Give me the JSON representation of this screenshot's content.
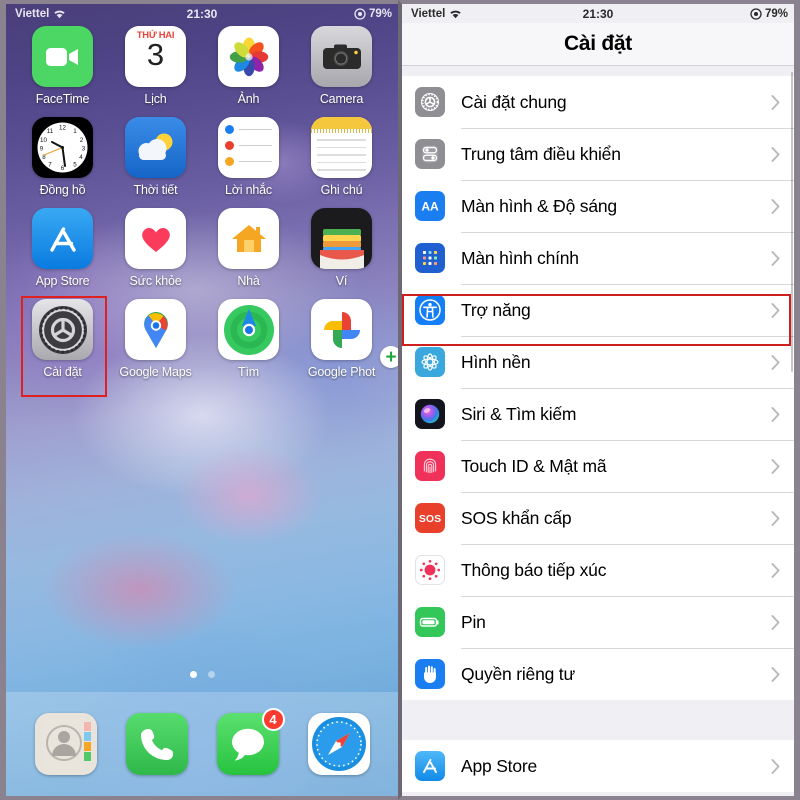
{
  "status_bar": {
    "carrier": "Viettel",
    "wifi_icon": "wifi-icon",
    "time": "21:30",
    "battery_percent": "79%",
    "battery_icon": "battery-icon"
  },
  "home_screen": {
    "rows": [
      [
        {
          "label": "FaceTime",
          "icon": "facetime-icon"
        },
        {
          "label": "Lịch",
          "icon": "calendar-icon",
          "weekday": "THỨ HAI",
          "day": "3"
        },
        {
          "label": "Ảnh",
          "icon": "photos-icon"
        },
        {
          "label": "Camera",
          "icon": "camera-icon"
        }
      ],
      [
        {
          "label": "Đồng hồ",
          "icon": "clock-icon"
        },
        {
          "label": "Thời tiết",
          "icon": "weather-icon"
        },
        {
          "label": "Lời nhắc",
          "icon": "reminders-icon"
        },
        {
          "label": "Ghi chú",
          "icon": "notes-icon"
        }
      ],
      [
        {
          "label": "App Store",
          "icon": "app-store-icon"
        },
        {
          "label": "Sức khỏe",
          "icon": "health-icon"
        },
        {
          "label": "Nhà",
          "icon": "home-app-icon"
        },
        {
          "label": "Ví",
          "icon": "wallet-icon"
        }
      ],
      [
        {
          "label": "Cài đặt",
          "icon": "settings-gear-icon",
          "highlighted": true
        },
        {
          "label": "Google Maps",
          "icon": "google-maps-icon"
        },
        {
          "label": "Tìm",
          "icon": "find-my-icon"
        },
        {
          "label": "Google Phot",
          "icon": "google-photos-icon",
          "plus_badge": "+"
        }
      ]
    ],
    "page_dots": {
      "count": 2,
      "active_index": 0
    },
    "dock": [
      {
        "label": "Danh bạ",
        "icon": "contacts-icon"
      },
      {
        "label": "Điện thoại",
        "icon": "phone-icon"
      },
      {
        "label": "Tin nhắn",
        "icon": "messages-icon",
        "badge": "4"
      },
      {
        "label": "Safari",
        "icon": "safari-icon"
      }
    ]
  },
  "settings_screen": {
    "title": "Cài đặt",
    "highlight_color": "#cf1f1f",
    "groups": [
      {
        "rows": [
          {
            "label": "Cài đặt chung",
            "icon": "gear-icon",
            "icon_color": "#8e8e93"
          },
          {
            "label": "Trung tâm điều khiển",
            "icon": "control-center-icon",
            "icon_color": "#8e8e93"
          },
          {
            "label": "Màn hình & Độ sáng",
            "icon": "display-brightness-icon",
            "icon_color": "#1a7ef0"
          },
          {
            "label": "Màn hình chính",
            "icon": "home-screen-icon",
            "icon_color": "#1f5fd0"
          },
          {
            "label": "Trợ năng",
            "icon": "accessibility-icon",
            "icon_color": "#147ef5",
            "highlighted": true
          },
          {
            "label": "Hình nền",
            "icon": "wallpaper-icon",
            "icon_color": "#3aa8dd"
          },
          {
            "label": "Siri & Tìm kiếm",
            "icon": "siri-icon",
            "icon_color": "#1b1b2e"
          },
          {
            "label": "Touch ID & Mật mã",
            "icon": "touch-id-icon",
            "icon_color": "#f0325a"
          },
          {
            "label": "SOS khẩn cấp",
            "icon": "sos-icon",
            "icon_color": "#e8402a"
          },
          {
            "label": "Thông báo tiếp xúc",
            "icon": "exposure-notification-icon",
            "icon_color": "#ffffff"
          },
          {
            "label": "Pin",
            "icon": "battery-icon",
            "icon_color": "#33c75a"
          },
          {
            "label": "Quyền riêng tư",
            "icon": "privacy-hand-icon",
            "icon_color": "#1a7ef0"
          }
        ]
      },
      {
        "rows": [
          {
            "label": "App Store",
            "icon": "app-store-icon",
            "icon_color": "#35a4f5"
          }
        ]
      }
    ],
    "chevron_icon": "chevron-right-icon"
  }
}
